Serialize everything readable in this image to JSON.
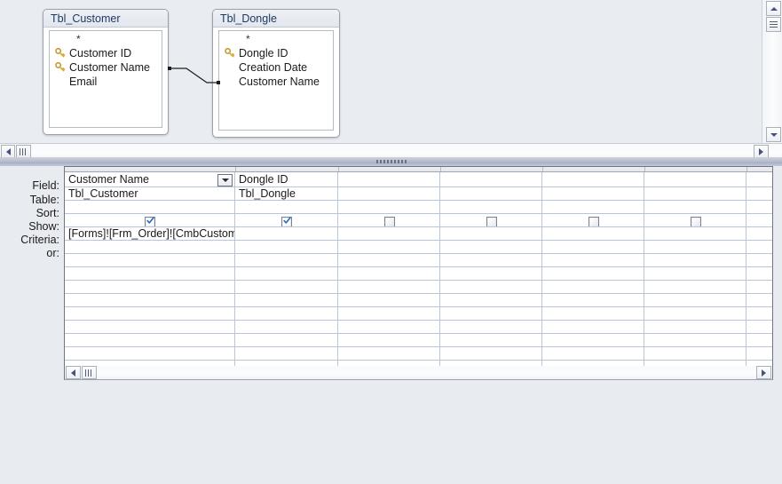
{
  "app": {
    "view": "Query Design"
  },
  "diagram": {
    "tables": [
      {
        "name": "Tbl_Customer",
        "fields": [
          {
            "label": "*",
            "key": false
          },
          {
            "label": "Customer ID",
            "key": true
          },
          {
            "label": "Customer Name",
            "key": true
          },
          {
            "label": "Email",
            "key": false
          }
        ]
      },
      {
        "name": "Tbl_Dongle",
        "fields": [
          {
            "label": "*",
            "key": false
          },
          {
            "label": "Dongle ID",
            "key": true
          },
          {
            "label": "Creation Date",
            "key": false
          },
          {
            "label": "Customer Name",
            "key": false
          }
        ]
      }
    ],
    "relationship": {
      "from_table": "Tbl_Customer",
      "from_field": "Customer Name",
      "to_table": "Tbl_Dongle",
      "to_field": "Customer Name"
    }
  },
  "grid": {
    "row_labels": {
      "field": "Field:",
      "table": "Table:",
      "sort": "Sort:",
      "show": "Show:",
      "criteria": "Criteria:",
      "or": "or:"
    },
    "columns": [
      {
        "field": "Customer Name",
        "table": "Tbl_Customer",
        "sort": "",
        "show": true,
        "criteria": "[Forms]![Frm_Order]![CmbCustomer]",
        "or": "",
        "has_combo": true
      },
      {
        "field": "Dongle ID",
        "table": "Tbl_Dongle",
        "sort": "",
        "show": true,
        "criteria": "",
        "or": "",
        "has_combo": false
      },
      {
        "field": "",
        "table": "",
        "sort": "",
        "show": false,
        "criteria": "",
        "or": "",
        "has_combo": false
      },
      {
        "field": "",
        "table": "",
        "sort": "",
        "show": false,
        "criteria": "",
        "or": "",
        "has_combo": false
      },
      {
        "field": "",
        "table": "",
        "sort": "",
        "show": false,
        "criteria": "",
        "or": "",
        "has_combo": false
      },
      {
        "field": "",
        "table": "",
        "sort": "",
        "show": false,
        "criteria": "",
        "or": "",
        "has_combo": false
      }
    ]
  },
  "colors": {
    "table_title": "#1f3864",
    "key_icon": "#d4a829",
    "grid_line": "#b9c6d8",
    "pane_background": "#e8ebef",
    "check_mark": "#2f6ec4",
    "scroll_arrow": "#45527a"
  },
  "scrollbars": {
    "diagram_vertical": {
      "up": "scroll-up-arrow",
      "down": "scroll-down-arrow",
      "thumb": "scroll-thumb"
    },
    "diagram_horizontal": {
      "left": "scroll-left-arrow",
      "right": "scroll-right-arrow",
      "thumb": "scroll-thumb"
    },
    "grid_horizontal": {
      "left": "scroll-left-arrow",
      "right": "scroll-right-arrow",
      "thumb": "scroll-thumb"
    }
  }
}
